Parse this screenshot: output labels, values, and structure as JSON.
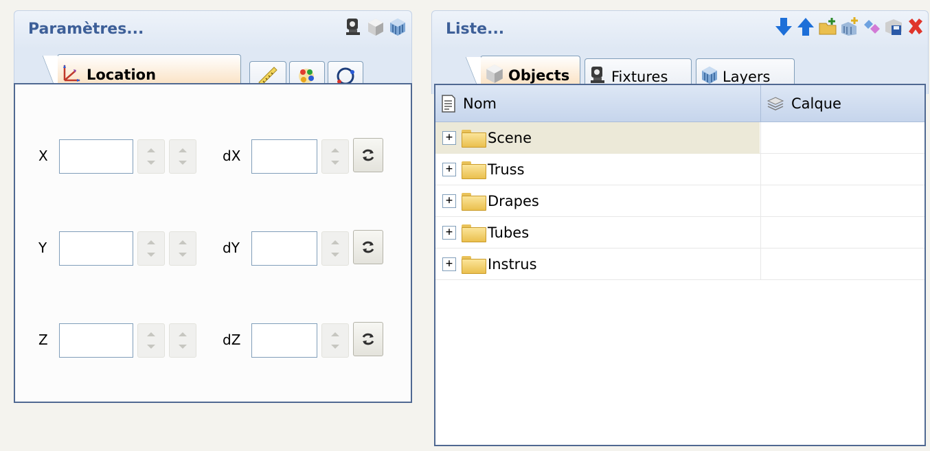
{
  "left_panel": {
    "title": "Paramètres...",
    "toolbar": [
      "fixture-icon",
      "cube-icon",
      "layers-icon"
    ],
    "tabs": [
      {
        "label": "Location",
        "icon": "axes-icon",
        "active": true
      },
      {
        "label": "",
        "icon": "ruler-icon"
      },
      {
        "label": "",
        "icon": "color-icon"
      },
      {
        "label": "",
        "icon": "rotate-icon"
      }
    ],
    "fields": [
      {
        "label": "X",
        "value": "",
        "delta_label": "dX",
        "delta_value": ""
      },
      {
        "label": "Y",
        "value": "",
        "delta_label": "dY",
        "delta_value": ""
      },
      {
        "label": "Z",
        "value": "",
        "delta_label": "dZ",
        "delta_value": ""
      }
    ]
  },
  "right_panel": {
    "title": "Liste...",
    "toolbar": [
      "arrow-down-icon",
      "arrow-up-icon",
      "new-folder-icon",
      "new-layer-icon",
      "link-icon",
      "save-icon",
      "delete-icon"
    ],
    "tabs": [
      {
        "label": "Objects",
        "icon": "cube-icon",
        "active": true
      },
      {
        "label": "Fixtures",
        "icon": "fixture-icon"
      },
      {
        "label": "Layers",
        "icon": "layers-icon"
      }
    ],
    "columns": [
      "Nom",
      "Calque"
    ],
    "rows": [
      {
        "name": "Scene",
        "layer": "",
        "selected": true
      },
      {
        "name": "Truss",
        "layer": ""
      },
      {
        "name": "Drapes",
        "layer": ""
      },
      {
        "name": "Tubes",
        "layer": ""
      },
      {
        "name": "Instrus",
        "layer": ""
      }
    ],
    "expand_glyph": "+"
  },
  "colors": {
    "title": "#3d5f98",
    "border": "#4f6891",
    "tab_active": "#f9d9b1",
    "selection": "#ece9d8"
  }
}
